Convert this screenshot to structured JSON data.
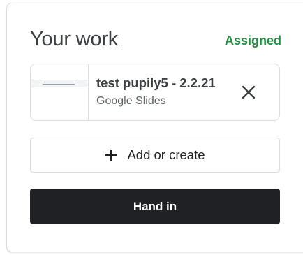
{
  "work_panel": {
    "title": "Your work",
    "status": "Assigned",
    "status_color": "#1e8e3e",
    "attachment": {
      "title": "test pupily5 - 2.2.21",
      "type": "Google Slides",
      "thumbnail_icon": "slides-thumbnail",
      "remove_icon": "close-icon"
    },
    "add_button": {
      "icon": "plus-icon",
      "label": "Add or create"
    },
    "hand_in_button": {
      "label": "Hand in",
      "background": "#202124"
    }
  }
}
